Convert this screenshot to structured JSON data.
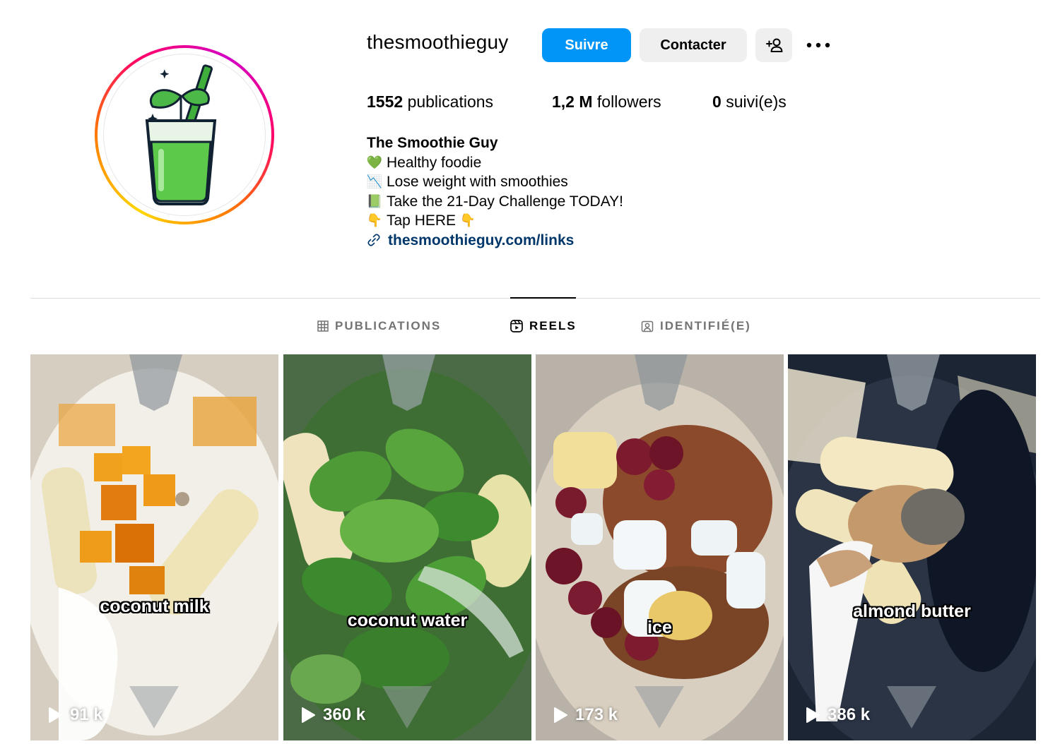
{
  "profile": {
    "username": "thesmoothieguy",
    "follow_label": "Suivre",
    "contact_label": "Contacter",
    "stats": {
      "posts_count": "1552",
      "posts_label": "publications",
      "followers_count": "1,2 M",
      "followers_label": "followers",
      "following_count": "0",
      "following_label": "suivi(e)s"
    },
    "bio": {
      "name": "The Smoothie Guy",
      "lines": [
        {
          "emoji": "💚",
          "text": "Healthy foodie"
        },
        {
          "emoji": "📉",
          "text": "Lose weight with smoothies"
        },
        {
          "emoji": "📗",
          "text": "Take the 21-Day Challenge TODAY!"
        },
        {
          "emoji": "👇",
          "text": "Tap HERE",
          "suffix": "👇"
        }
      ],
      "link": "thesmoothieguy.com/links"
    }
  },
  "tabs": [
    {
      "label": "PUBLICATIONS",
      "icon": "grid-icon",
      "active": false
    },
    {
      "label": "REELS",
      "icon": "reels-icon",
      "active": true
    },
    {
      "label": "IDENTIFIÉ(E)",
      "icon": "tagged-icon",
      "active": false
    }
  ],
  "reels": [
    {
      "caption": "coconut milk",
      "views": "91 k"
    },
    {
      "caption": "coconut water",
      "views": "360 k"
    },
    {
      "caption": "ice",
      "views": "173 k"
    },
    {
      "caption": "almond butter",
      "views": "386 k"
    }
  ],
  "colors": {
    "follow_button": "#0095f6",
    "secondary_button": "#efefef",
    "link": "#00376b",
    "divider": "#dbdbdb",
    "inactive_tab": "#737373"
  }
}
